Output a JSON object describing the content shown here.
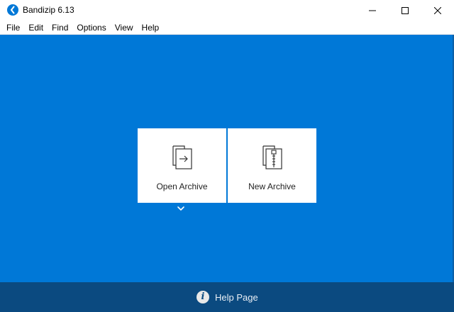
{
  "window": {
    "title": "Bandizip 6.13",
    "icon": "bandizip-logo-icon",
    "controls": [
      "minimize-icon",
      "maximize-icon",
      "close-icon"
    ]
  },
  "menu": [
    "File",
    "Edit",
    "Find",
    "Options",
    "View",
    "Help"
  ],
  "actions": {
    "open_archive": {
      "label": "Open Archive",
      "icon": "open-archive-icon"
    },
    "new_archive": {
      "label": "New Archive",
      "icon": "new-archive-icon"
    },
    "expand_icon": "chevron-down-icon"
  },
  "footer": {
    "help_label": "Help Page",
    "help_icon": "info-icon",
    "help_icon_glyph": "i"
  },
  "colors": {
    "main_background": "#0078d7",
    "footer_background": "#0b4a80",
    "card_background": "#ffffff"
  }
}
